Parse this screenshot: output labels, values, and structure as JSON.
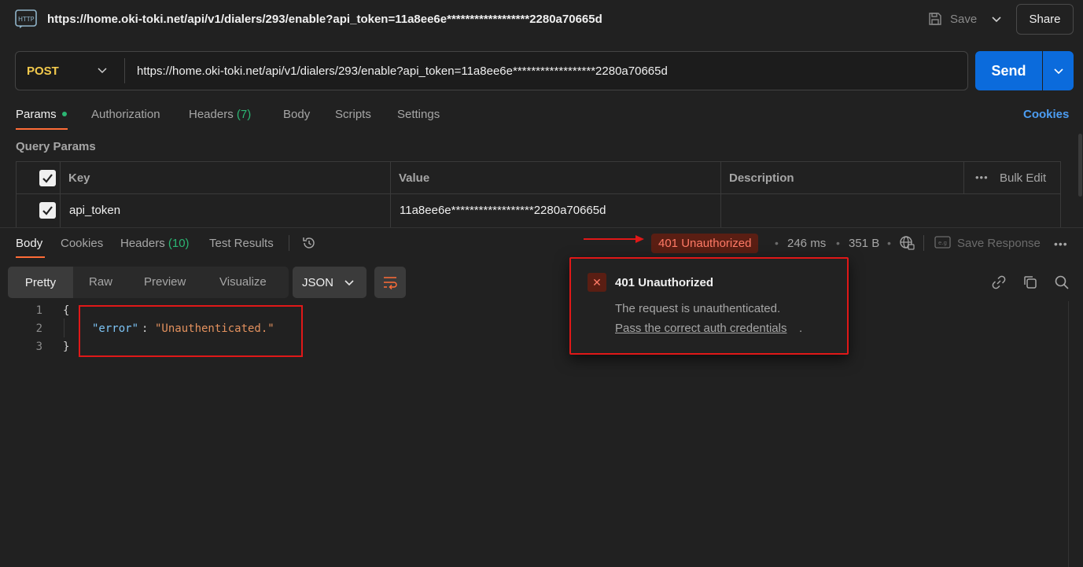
{
  "header": {
    "url": "https://home.oki-toki.net/api/v1/dialers/293/enable?api_token=11a8ee6e******************2280a70665d",
    "save_label": "Save",
    "share_label": "Share"
  },
  "request": {
    "method": "POST",
    "url": "https://home.oki-toki.net/api/v1/dialers/293/enable?api_token=11a8ee6e******************2280a70665d",
    "send_label": "Send",
    "method_color": "#f2c94c"
  },
  "request_tabs": {
    "params": "Params",
    "authorization": "Authorization",
    "headers": "Headers",
    "headers_count": "(7)",
    "body": "Body",
    "scripts": "Scripts",
    "settings": "Settings",
    "cookies": "Cookies"
  },
  "query_params": {
    "title": "Query Params",
    "columns": {
      "key": "Key",
      "value": "Value",
      "description": "Description"
    },
    "bulk_edit": "Bulk Edit",
    "rows": [
      {
        "key": "api_token",
        "value": "11a8ee6e******************2280a70665d",
        "description": ""
      }
    ]
  },
  "response_tabs": {
    "body": "Body",
    "cookies": "Cookies",
    "headers": "Headers",
    "headers_count": "(10)",
    "test_results": "Test Results"
  },
  "response_meta": {
    "status": "401 Unauthorized",
    "time": "246 ms",
    "size": "351 B",
    "save_response": "Save Response"
  },
  "view": {
    "pretty": "Pretty",
    "raw": "Raw",
    "preview": "Preview",
    "visualize": "Visualize",
    "format": "JSON"
  },
  "code": {
    "line_numbers": [
      "1",
      "2",
      "3"
    ],
    "open_brace": "{",
    "key": "\"error\"",
    "colon": ":",
    "value": "\"Unauthenticated.\"",
    "close_brace": "}"
  },
  "tooltip": {
    "title": "401 Unauthorized",
    "description": "The request is unauthenticated.",
    "link": "Pass the correct auth credentials",
    "period": "."
  },
  "colors": {
    "accent": "#ff6c37",
    "send_blue": "#0b6bdc",
    "error": "#ff7a66",
    "highlight_red": "#e01818"
  }
}
